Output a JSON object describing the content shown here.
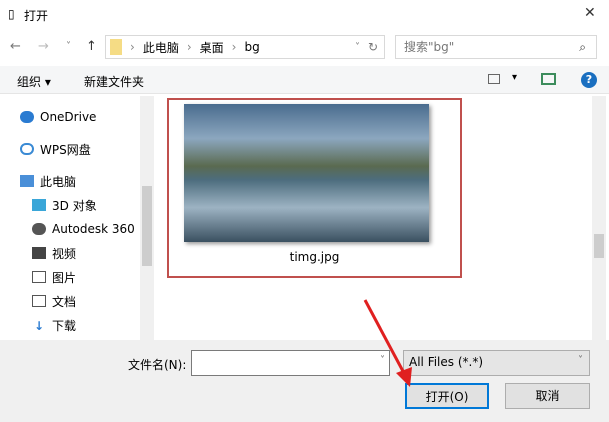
{
  "window": {
    "title": "打开",
    "close": "✕"
  },
  "nav": {
    "back": "←",
    "forward": "→",
    "recent": "˅",
    "up": "↑"
  },
  "address": {
    "crumbs": [
      "此电脑",
      "桌面",
      "bg"
    ],
    "sep": "›",
    "dropdown": "˅",
    "refresh": "↻"
  },
  "search": {
    "placeholder": "搜索\"bg\"",
    "icon": "⌕"
  },
  "toolbar": {
    "organize": "组织 ▾",
    "new_folder": "新建文件夹",
    "view": "▾",
    "help": "?"
  },
  "sidebar": {
    "items": [
      {
        "label": "OneDrive"
      },
      {
        "label": "WPS网盘"
      },
      {
        "label": "此电脑"
      },
      {
        "label": "3D 对象"
      },
      {
        "label": "Autodesk 360"
      },
      {
        "label": "视频"
      },
      {
        "label": "图片"
      },
      {
        "label": "文档"
      },
      {
        "label": "下载"
      }
    ]
  },
  "files": [
    {
      "name": "timg.jpg"
    }
  ],
  "bottom": {
    "filename_label": "文件名(N):",
    "filename_value": "",
    "filter": "All Files (*.*)",
    "open": "打开(O)",
    "cancel": "取消"
  },
  "colors": {
    "selection": "#c0504d",
    "accent": "#0078d7"
  }
}
